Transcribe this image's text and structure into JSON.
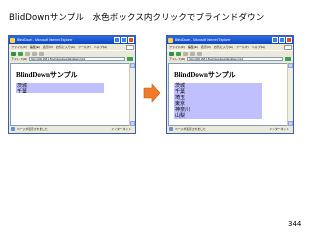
{
  "slide": {
    "title": "BlidDownサンプル　水色ボックス内クリックでブラインドダウン",
    "page_number": "344"
  },
  "browser": {
    "window_title": "BlindDown - Microsoft Internet Explorer",
    "menu": [
      "ファイル(F)",
      "編集(E)",
      "表示(V)",
      "お気に入り(A)",
      "ツール(T)",
      "ヘルプ(H)"
    ],
    "address_label": "アドレス(D)",
    "address_value": "http://192.168.1.5/scriptaculous/blinddown.html",
    "status_text": "ページが表示されました",
    "zone_text": "インターネット"
  },
  "left_window": {
    "heading": "BlindDownサンプル",
    "list_items": [
      "茨城",
      "千葉"
    ]
  },
  "right_window": {
    "heading": "BlindDownサンプル",
    "list_items": [
      "茨城",
      "千葉",
      "埼玉",
      "東京",
      "神奈川",
      "山梨"
    ]
  },
  "colors": {
    "list_box": "#c0c0ff",
    "arrow": "#f07a2a",
    "titlebar": "#0a46c4"
  },
  "icons": [
    "app-icon",
    "minimize-icon",
    "maximize-icon",
    "close-icon",
    "back-icon",
    "forward-icon",
    "go-icon",
    "status-page-icon",
    "arrow-right-icon"
  ]
}
